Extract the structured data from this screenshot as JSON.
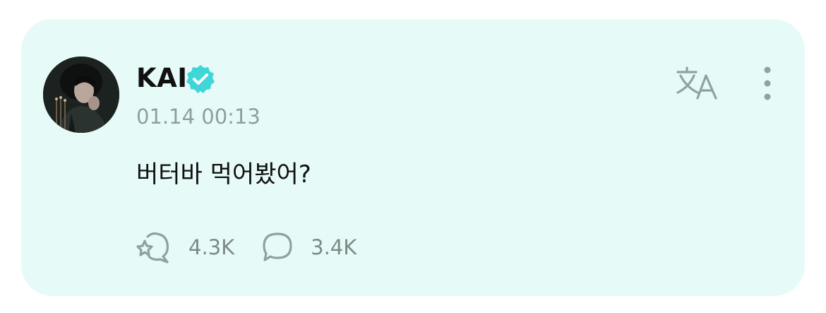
{
  "post": {
    "author": "KAI",
    "timestamp": "01.14 00:13",
    "body": "버터바 먹어봤어?",
    "likes": "4.3K",
    "comments": "3.4K"
  },
  "colors": {
    "card_background": "#e6fbf8",
    "verified_badge": "#3fd6d8",
    "muted_text": "#8f9e9b",
    "icon": "#8ea3a1"
  },
  "icons": {
    "verified": "verified-badge-icon",
    "translate": "translate-icon",
    "more": "more-vertical-icon",
    "like": "heart-fan-icon",
    "comment": "comment-bubble-icon"
  }
}
